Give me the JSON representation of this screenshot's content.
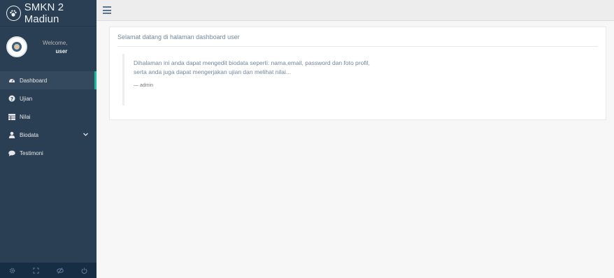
{
  "brand": {
    "title": "SMKN 2 Madiun",
    "icon": "paw-icon"
  },
  "profile": {
    "welcome": "Welcome,",
    "username": "user"
  },
  "menu": [
    {
      "label": "Dashboard",
      "icon": "dashboard-icon",
      "active": true
    },
    {
      "label": "Ujian",
      "icon": "question-circle-icon"
    },
    {
      "label": "Nilai",
      "icon": "table-icon"
    },
    {
      "label": "Biodata",
      "icon": "user-icon",
      "dropdown": true
    },
    {
      "label": "Testimoni",
      "icon": "comment-icon"
    }
  ],
  "footer_icons": [
    "settings-icon",
    "fullscreen-icon",
    "eye-slash-icon",
    "power-icon"
  ],
  "panel": {
    "title": "Selamat datang di halaman dashboard user",
    "quote_line1": "Dihalaman ini anda dapat mengedit biodata seperti: nama,email, password dan foto profil,",
    "quote_line2": "serta anda juga dapat mengerjakan ujian dan melihat nilai...",
    "author": "— admin"
  },
  "colors": {
    "sidebar": "#2a3f54",
    "accent": "#1abb9c",
    "text": "#73879c"
  }
}
